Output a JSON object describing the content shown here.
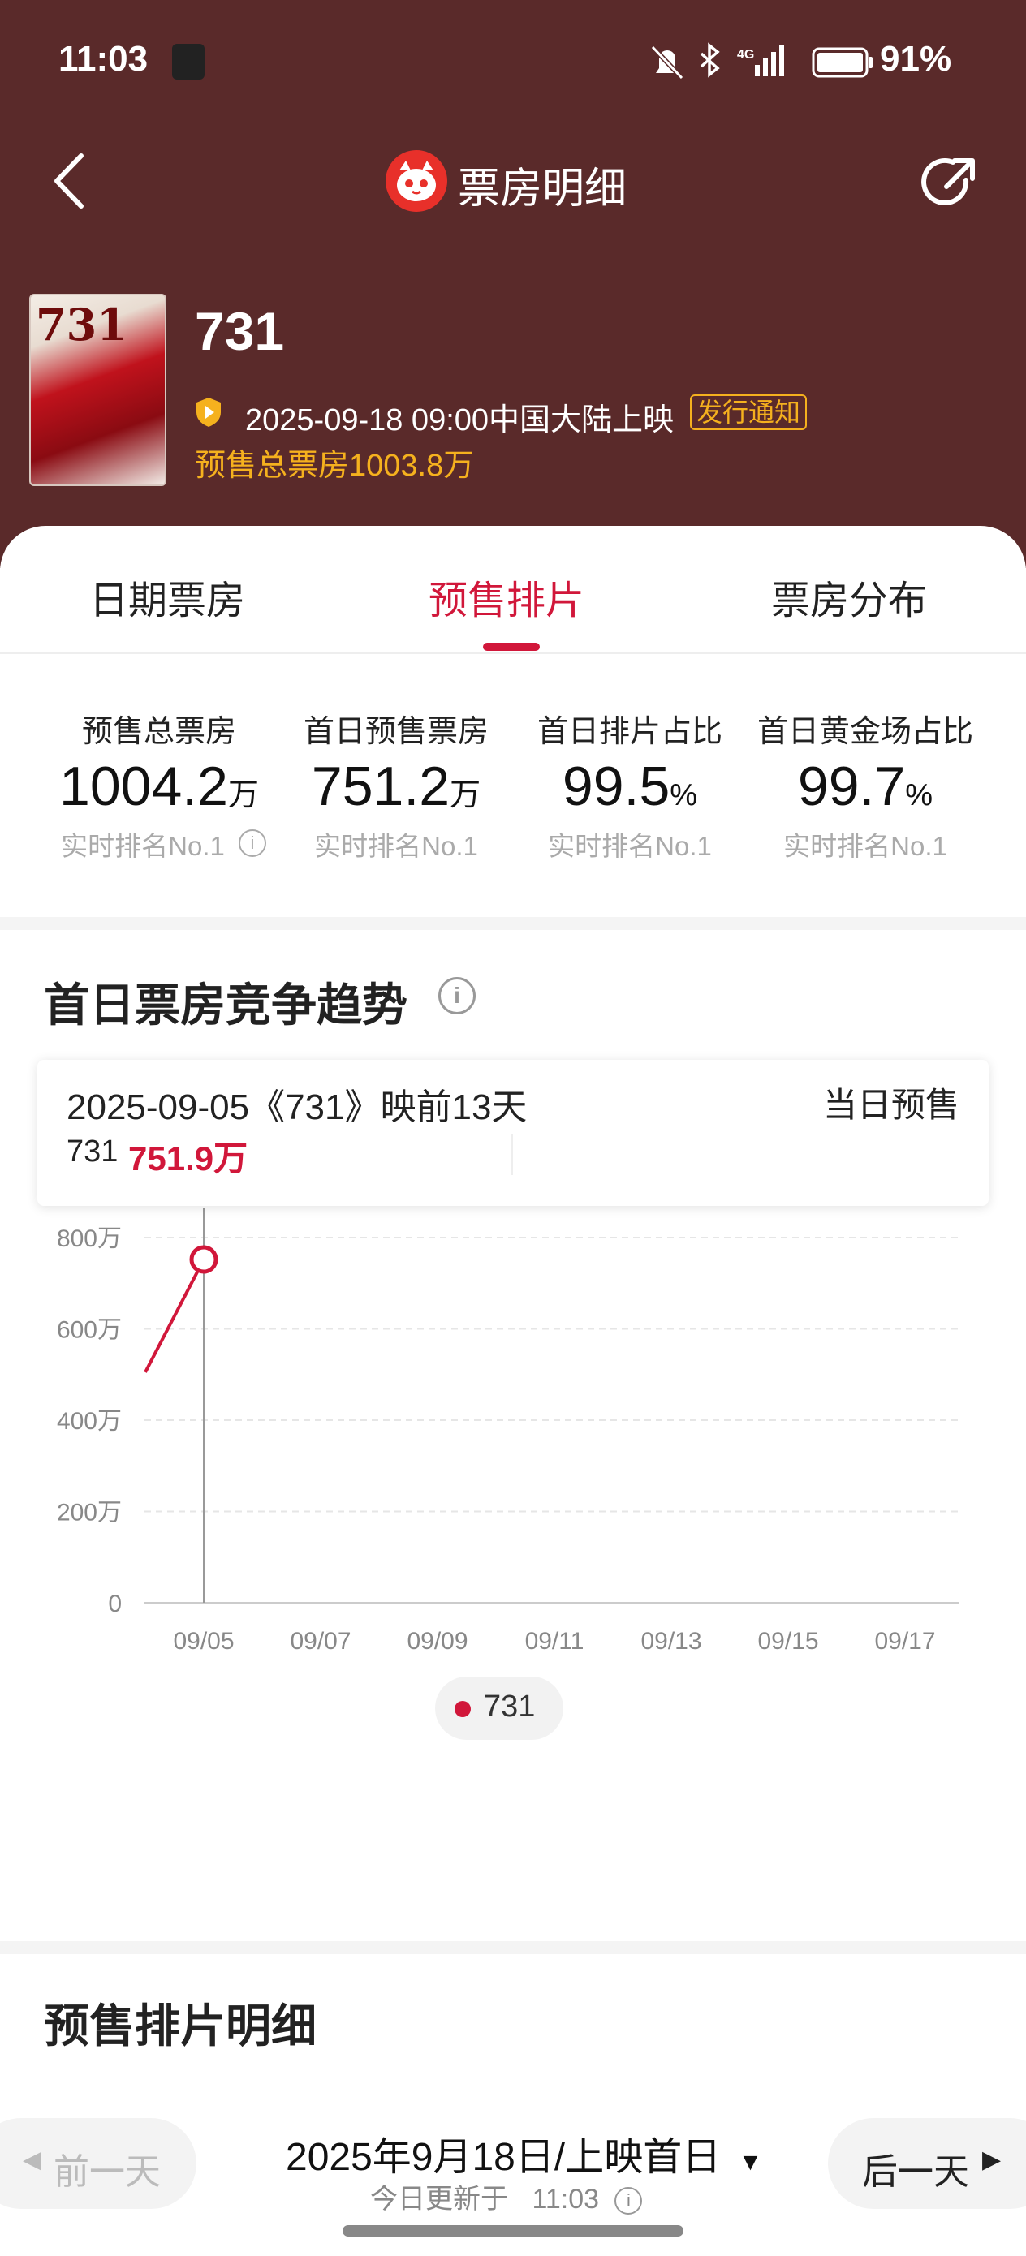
{
  "status_bar": {
    "time": "11:03",
    "battery": "91%",
    "network": "4G"
  },
  "nav": {
    "title": "票房明细",
    "back_icon": "back-chevron-icon",
    "share_icon": "share-icon",
    "logo_icon": "cat-logo-icon"
  },
  "movie": {
    "poster_text": "731",
    "title": "731",
    "release": "2025-09-18 09:00中国大陆上映",
    "notice_badge": "发行通知",
    "presale_total": "预售总票房1003.8万"
  },
  "tabs": [
    {
      "label": "日期票房",
      "active": false
    },
    {
      "label": "预售排片",
      "active": true
    },
    {
      "label": "票房分布",
      "active": false
    }
  ],
  "stats": [
    {
      "label": "预售总票房",
      "value": "1004.2",
      "unit": "万",
      "rank": "实时排名No.1",
      "info": true
    },
    {
      "label": "首日预售票房",
      "value": "751.2",
      "unit": "万",
      "rank": "实时排名No.1",
      "info": false
    },
    {
      "label": "首日排片占比",
      "value": "99.5",
      "unit": "%",
      "rank": "实时排名No.1",
      "info": false
    },
    {
      "label": "首日黄金场占比",
      "value": "99.7",
      "unit": "%",
      "rank": "实时排名No.1",
      "info": false
    }
  ],
  "trend": {
    "title": "首日票房竞争趋势",
    "tooltip": {
      "date_line": "2025-09-05《731》映前13天",
      "kind": "当日预售",
      "series_name": "731",
      "value": "751.9万"
    }
  },
  "chart_data": {
    "type": "line",
    "y_ticks": [
      "800万",
      "600万",
      "400万",
      "200万",
      "0"
    ],
    "x_ticks": [
      "09/05",
      "09/07",
      "09/09",
      "09/11",
      "09/13",
      "09/15",
      "09/17"
    ],
    "ylim": [
      0,
      800
    ],
    "unit": "万",
    "grid": true,
    "series": [
      {
        "name": "731",
        "x": [
          "09/04",
          "09/05"
        ],
        "values": [
          505,
          751.9
        ],
        "color": "#d1173a"
      }
    ],
    "highlight": {
      "x": "09/05",
      "value": 751.9
    },
    "legend": [
      "731"
    ]
  },
  "detail": {
    "title": "预售排片明细",
    "prev_day": "前一天",
    "next_day": "后一天",
    "date_label": "2025年9月18日/上映首日",
    "updated_prefix": "今日更新于",
    "updated_time": "11:03"
  },
  "colors": {
    "header": "#5a2a2a",
    "accent": "#d1173a",
    "gold": "#f5b11e"
  }
}
